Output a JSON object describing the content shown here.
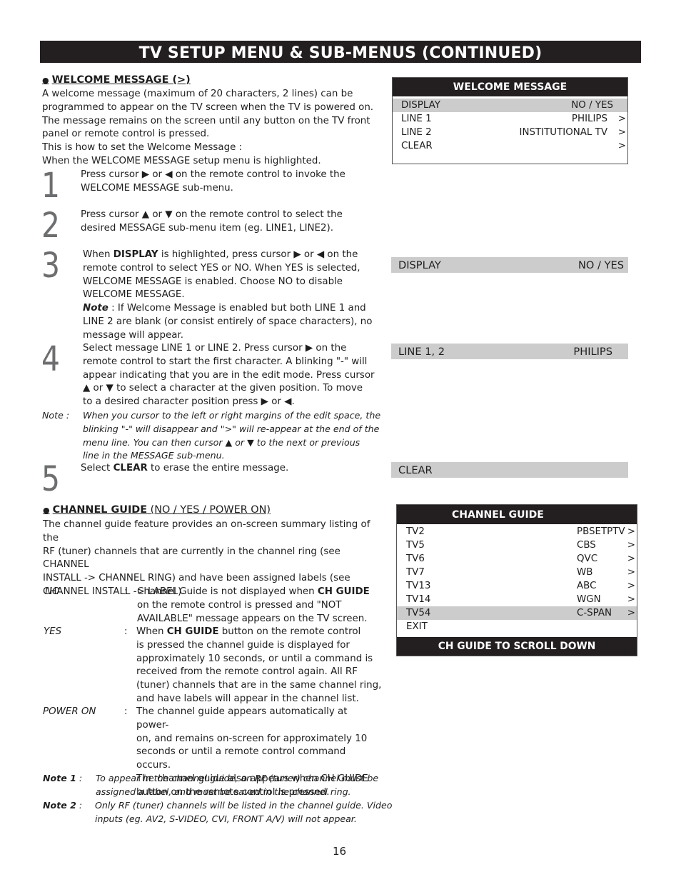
{
  "banner": {
    "title": "TV SETUP MENU & SUB-MENUS (CONTINUED)"
  },
  "welcome": {
    "heading": "WELCOME MESSAGE (>)",
    "intro": [
      "A welcome message (maximum of 20 characters, 2 lines) can be",
      "programmed to appear on the TV screen when the TV is powered on.",
      "The message remains on the screen until any button on the TV front",
      "panel or remote control is pressed.",
      "This is how to set the Welcome Message :",
      "When the WELCOME MESSAGE setup menu is highlighted."
    ],
    "steps": [
      {
        "num": "1",
        "lines": [
          "Press cursor ▶ or ◀ on the remote control to invoke the",
          "WELCOME MESSAGE sub-menu."
        ]
      },
      {
        "num": "2",
        "lines": [
          "Press cursor ▲ or ▼ on the remote control to select the",
          "desired MESSAGE sub-menu item (eg. LINE1, LINE2)."
        ]
      },
      {
        "num": "3",
        "line1_pre": "When ",
        "line1_bold": "DISPLAY",
        "line1_post": " is highlighted, press cursor ▶ or ◀ on the",
        "lines": [
          "remote control to select YES or NO. When YES is selected,",
          "WELCOME MESSAGE is enabled. Choose NO to disable",
          "WELCOME MESSAGE."
        ],
        "note_label": "Note",
        "note_lines": [
          " : If Welcome Message is enabled but both LINE 1 and",
          "LINE 2 are blank (or consist entirely of space characters), no",
          "message will appear."
        ]
      },
      {
        "num": "4",
        "lines": [
          "Select message LINE 1 or LINE 2.   Press cursor ▶ on the",
          "remote control to start the first character.  A blinking \"-\" will",
          "appear indicating that you are in the edit mode.  Press cursor",
          "▲ or ▼ to select a character at the given position. To move",
          "to a desired character position press ▶ or ◀."
        ],
        "note_label": "Note :",
        "note_lines": [
          "When you cursor to the left or right margins of the edit space, the",
          "blinking \"-\" will disappear and \">\" will re-appear at the end of the",
          "menu line.  You can then cursor ▲ or ▼ to the next or previous",
          "line in the MESSAGE sub-menu."
        ]
      },
      {
        "num": "5",
        "pre": "Select ",
        "bold": "CLEAR",
        "post": "  to erase the entire message."
      }
    ],
    "menu": {
      "title": "WELCOME MESSAGE",
      "rows": [
        {
          "label": "DISPLAY",
          "value": "NO / YES",
          "arrow": "",
          "highlighted": true
        },
        {
          "label": "LINE 1",
          "value": "PHILIPS",
          "arrow": ">",
          "highlighted": false
        },
        {
          "label": "LINE 2",
          "value": "INSTITUTIONAL TV",
          "arrow": ">",
          "highlighted": false
        },
        {
          "label": "CLEAR",
          "value": "",
          "arrow": ">",
          "highlighted": false
        }
      ]
    },
    "bars": {
      "display": {
        "label": "DISPLAY",
        "value": "NO / YES"
      },
      "line": {
        "label": "LINE 1, 2",
        "value": "PHILIPS"
      },
      "clear": {
        "label": "CLEAR"
      }
    }
  },
  "channel_guide": {
    "heading_bold": "CHANNEL GUIDE",
    "heading_sub": "(NO / YES / POWER ON)",
    "intro": [
      "The channel guide feature provides an on-screen summary listing of the",
      "RF (tuner) channels that are currently in the channel ring (see CHANNEL",
      "INSTALL -> CHANNEL RING) and have been assigned labels (see",
      "CHANNEL INSTALL -> LABEL)."
    ],
    "options": [
      {
        "term": "NO",
        "line1_pre": "Channel Guide is not displayed when ",
        "line1_bold": "CH GUIDE",
        "line1_post": "",
        "lines": [
          "on the remote control is pressed and \"NOT",
          "AVAILABLE\" message appears on the TV screen."
        ]
      },
      {
        "term": "YES",
        "line1_pre": "When ",
        "line1_bold": "CH GUIDE",
        "line1_post": " button on the remote control",
        "lines": [
          "is pressed the channel guide is displayed for",
          "approximately 10 seconds, or until a command is",
          "received from the remote control again. All RF",
          "(tuner) channels that are in the same channel ring,",
          "and have labels will appear in the channel list."
        ]
      },
      {
        "term": "POWER ON",
        "line1_pre": "The channel guide appears automatically at power-",
        "line1_bold": "",
        "line1_post": "",
        "lines": [
          "on, and remains on-screen for approximately 10",
          "seconds or until a remote control command occurs.",
          "The channel guide also appears when CH GUIDE",
          "button on the remote control is pressed."
        ]
      }
    ],
    "notes": [
      {
        "label": "Note 1",
        "sep": " :",
        "lines": [
          "To appear in the channel guide, an RF (tuner) channel must be",
          "assigned a label, and must be saved in the channel ring."
        ]
      },
      {
        "label": "Note 2",
        "sep": "  :",
        "lines": [
          "Only RF (tuner) channels will be listed in the channel guide.  Video",
          "inputs (eg. AV2, S-VIDEO, CVI, FRONT A/V) will not appear."
        ]
      }
    ],
    "menu": {
      "title": "CHANNEL GUIDE",
      "rows": [
        {
          "channel": "TV2",
          "label": "PBSETPTV",
          "arrow": ">",
          "highlighted": false
        },
        {
          "channel": "TV5",
          "label": "CBS",
          "arrow": ">",
          "highlighted": false
        },
        {
          "channel": "TV6",
          "label": "QVC",
          "arrow": ">",
          "highlighted": false
        },
        {
          "channel": "TV7",
          "label": "WB",
          "arrow": ">",
          "highlighted": false
        },
        {
          "channel": "TV13",
          "label": "ABC",
          "arrow": ">",
          "highlighted": false
        },
        {
          "channel": "TV14",
          "label": "WGN",
          "arrow": ">",
          "highlighted": false
        },
        {
          "channel": "TV54",
          "label": "C-SPAN",
          "arrow": ">",
          "highlighted": true
        },
        {
          "channel": "EXIT",
          "label": "",
          "arrow": "",
          "highlighted": false
        }
      ],
      "footer": "CH GUIDE TO SCROLL DOWN"
    }
  },
  "page_number": "16",
  "colors": {
    "banner_bg": "#231f20",
    "highlight": "#cccccc",
    "step_number": "#6d6e70"
  }
}
